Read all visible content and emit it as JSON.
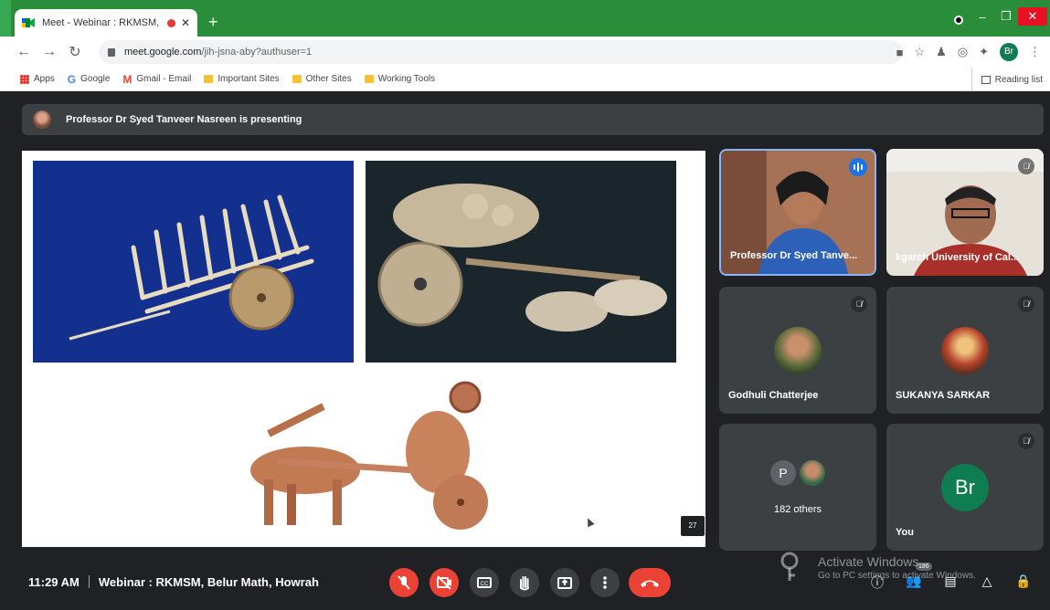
{
  "browser": {
    "tab_title": "Meet - Webinar : RKMSM, Be",
    "url_host": "meet.google.com",
    "url_path": "/jih-jsna-aby?authuser=1",
    "profile_initials": "Br",
    "bookmarks": [
      {
        "label": "Apps",
        "icon": "apps-grid-icon"
      },
      {
        "label": "Google",
        "icon": "google-icon"
      },
      {
        "label": "Gmail - Email",
        "icon": "gmail-icon"
      },
      {
        "label": "Important Sites",
        "icon": "folder-icon"
      },
      {
        "label": "Other Sites",
        "icon": "folder-icon"
      },
      {
        "label": "Working Tools",
        "icon": "folder-icon"
      }
    ],
    "reading_list": "Reading list"
  },
  "meet": {
    "presenting_banner": "Professor Dr Syed Tanveer Nasreen is presenting",
    "slide_number": "27",
    "tiles": [
      {
        "name": "Professor Dr Syed Tanve...",
        "speaking": true
      },
      {
        "name": "kgarch University of Cal...",
        "muted": true
      },
      {
        "name": "Godhuli Chatterjee",
        "muted": true
      },
      {
        "name": "SUKANYA SARKAR",
        "muted": true
      },
      {
        "others_initial": "P",
        "others_label": "182 others"
      },
      {
        "name": "You",
        "avatar_initials": "Br",
        "muted": true
      }
    ],
    "time": "11:29 AM",
    "meeting_title": "Webinar : RKMSM, Belur Math, Howrah",
    "participants_badge": "186"
  },
  "watermark": {
    "line1": "Activate Windows",
    "line2": "Go to PC settings to activate Windows."
  },
  "colors": {
    "chrome_green": "#2a8d3a",
    "meet_bg": "#202124",
    "end_call": "#ea4335",
    "avatar": "#0f7d52"
  }
}
